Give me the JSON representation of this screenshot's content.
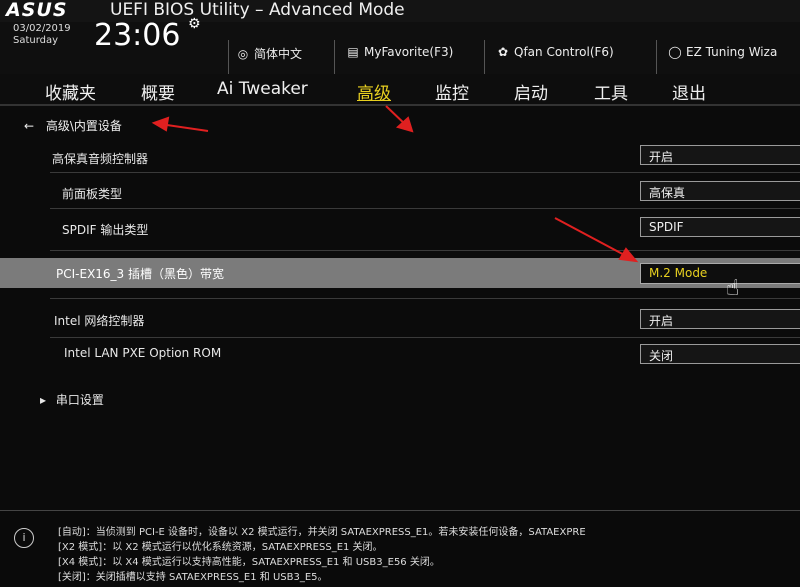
{
  "window": {
    "logo": "ASUS",
    "title": "UEFI BIOS Utility – Advanced Mode"
  },
  "status": {
    "date": "03/02/2019",
    "day": "Saturday",
    "time": "23:06"
  },
  "toolbar": {
    "language": "简体中文",
    "favorite": "MyFavorite(F3)",
    "qfan": "Qfan Control(F6)",
    "ez_tuning": "EZ Tuning Wiza"
  },
  "menu": [
    {
      "label": "收藏夹"
    },
    {
      "label": "概要"
    },
    {
      "label": "Ai Tweaker"
    },
    {
      "label": "高级"
    },
    {
      "label": "监控"
    },
    {
      "label": "启动"
    },
    {
      "label": "工具"
    },
    {
      "label": "退出"
    }
  ],
  "breadcrumb": "高级\\内置设备",
  "settings": [
    {
      "label": "高保真音频控制器",
      "value": "开启"
    },
    {
      "label": "前面板类型",
      "value": "高保真"
    },
    {
      "label": "SPDIF 输出类型",
      "value": "SPDIF"
    },
    {
      "label": "PCI-EX16_3 插槽（黑色）带宽",
      "value": "M.2 Mode"
    },
    {
      "label": "Intel 网络控制器",
      "value": "开启"
    },
    {
      "label": "Intel LAN PXE Option ROM",
      "value": "关闭"
    }
  ],
  "submenu": "串口设置",
  "help": [
    "[自动]：当侦测到 PCI-E 设备时，设备以 X2 模式运行，并关闭 SATAEXPRESS_E1。若未安装任何设备，SATAEXPRE",
    "[X2 模式]：以 X2 模式运行以优化系统资源，SATAEXPRESS_E1 关闭。",
    "[X4 模式]：以 X4 模式运行以支持高性能，SATAEXPRESS_E1 和 USB3_E56 关闭。",
    "[关闭]：关闭插槽以支持 SATAEXPRESS_E1 和 USB3_E5。"
  ],
  "colors": {
    "accent": "#e8d020",
    "highlight_row": "#7b7b7b",
    "annotation": "#e02020"
  }
}
